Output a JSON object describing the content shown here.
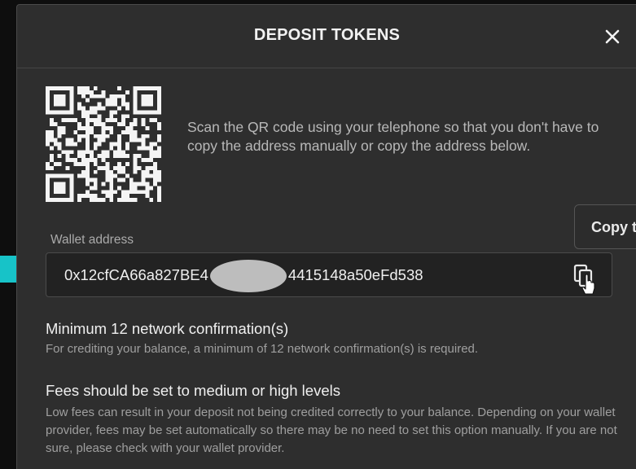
{
  "modal": {
    "title": "DEPOSIT TOKENS",
    "close_icon": "close-icon"
  },
  "qr": {
    "icon": "qr-code-icon"
  },
  "instructions": "Scan the QR code using your telephone so that you don't have to copy the address manually or copy the address below.",
  "tooltip": {
    "label": "Copy t"
  },
  "wallet": {
    "label": "Wallet address",
    "address_start": "0x12cfCA66a827BE4",
    "address_end": "4415148a50eFd538",
    "copy_icon": "copy-icon"
  },
  "info": [
    {
      "title": "Minimum 12 network confirmation(s)",
      "text": "For crediting your balance, a minimum of 12 network confirmation(s) is required."
    },
    {
      "title": "Fees should be set to medium or high levels",
      "text": "Low fees can result in your deposit not being credited correctly to your balance. Depending on your wallet provider, fees may be set automatically so there may be no need to set this option manually. If you are not sure, please check with your wallet provider."
    }
  ],
  "colors": {
    "background": "#0e0e0e",
    "modal": "#2e2e2e",
    "marker": "#17c3c8"
  }
}
